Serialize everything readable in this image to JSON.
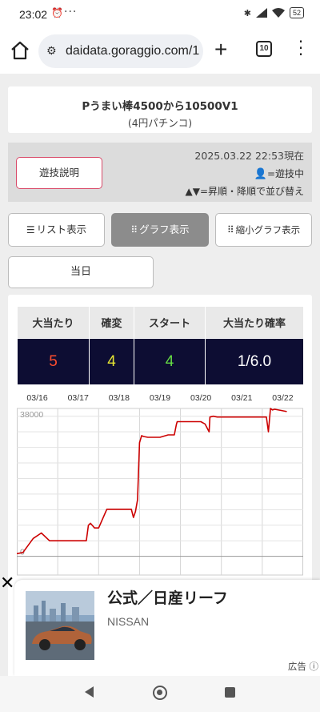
{
  "status_bar": {
    "time": "23:02",
    "alarm_icon": "alarm-icon",
    "more": "···",
    "battery": "52"
  },
  "browser": {
    "url": "daidata.goraggio.com/1",
    "new_tab": "+",
    "tab_count": "10"
  },
  "machine": {
    "name": "Pうまい棒4500から10500V1",
    "category": "(4円パチンコ)"
  },
  "info": {
    "rules_button": "遊技説明",
    "datetime": "2025.03.22 22:53現在",
    "playing_label": "=遊技中",
    "sort_note": "▲▼=昇順・降順で並び替え"
  },
  "view_buttons": {
    "list": "リスト表示",
    "graph": "グラフ表示",
    "small_graph": "縮小グラフ表示"
  },
  "day_button": "当日",
  "stats": {
    "headers": [
      "大当たり",
      "確変",
      "スタート",
      "大当たり確率"
    ],
    "values": [
      "5",
      "4",
      "4",
      "1/6.0"
    ],
    "colors": [
      "#ff4d2e",
      "#e6e633",
      "#66dd44",
      "#ffffff"
    ]
  },
  "chart_data": {
    "type": "line",
    "x_labels": [
      "03/16",
      "03/17",
      "03/18",
      "03/19",
      "03/20",
      "03/21",
      "03/22"
    ],
    "y_tick_labels": [
      "38000",
      "0"
    ],
    "ylim": [
      -4800,
      38000
    ],
    "grid": true,
    "line_color": "#cc0000",
    "x": [
      0,
      0.15,
      0.4,
      0.6,
      0.8,
      1.0,
      1.3,
      1.6,
      1.7,
      1.75,
      1.8,
      1.9,
      2.0,
      2.2,
      2.5,
      2.7,
      2.8,
      2.85,
      2.9,
      2.95,
      3.0,
      3.05,
      3.1,
      3.2,
      3.35,
      3.5,
      3.7,
      3.85,
      3.9,
      3.92,
      4.0,
      4.1,
      4.2,
      4.3,
      4.5,
      4.6,
      4.7,
      4.72,
      4.8,
      4.9,
      5.2,
      5.6,
      5.9,
      6.1,
      6.15,
      6.2,
      6.25,
      6.3,
      6.45,
      6.6
    ],
    "y": [
      700,
      1000,
      4600,
      6000,
      4000,
      4000,
      4000,
      4000,
      4000,
      8000,
      8500,
      7300,
      7300,
      12100,
      12100,
      12100,
      12100,
      10000,
      11500,
      14500,
      29200,
      31000,
      30800,
      30600,
      30600,
      30600,
      31200,
      31200,
      33900,
      34600,
      34600,
      34600,
      34600,
      34600,
      34600,
      34000,
      32000,
      35800,
      36000,
      35800,
      35800,
      35800,
      35800,
      35800,
      32000,
      38000,
      37600,
      37800,
      37500,
      37200
    ]
  },
  "ad": {
    "title": "公式／日産リーフ",
    "brand": "NISSAN",
    "label": "広告",
    "close": "✕"
  }
}
